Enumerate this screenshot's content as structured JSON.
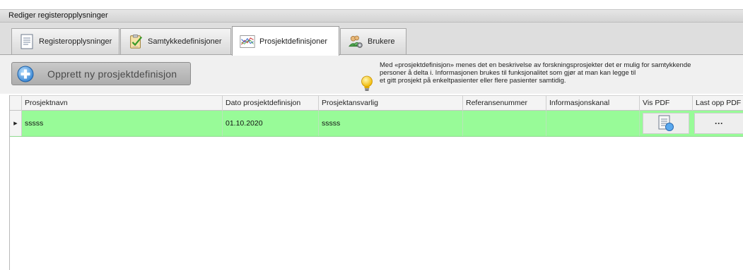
{
  "window": {
    "title": "Rediger registeropplysninger"
  },
  "tabs": [
    {
      "label": "Registeropplysninger",
      "icon": "document-icon",
      "active": false
    },
    {
      "label": "Samtykkedefinisjoner",
      "icon": "clipboard-check-icon",
      "active": false
    },
    {
      "label": "Prosjektdefinisjoner",
      "icon": "chart-icon",
      "active": true
    },
    {
      "label": "Brukere",
      "icon": "users-gear-icon",
      "active": false
    }
  ],
  "toolbar": {
    "new_button_label": "Opprett ny prosjektdefinisjon",
    "info_icon": "lightbulb-icon",
    "info_lines": [
      "Med «prosjektdefinisjon» menes det en beskrivelse av forskningsprosjekter det er mulig for samtykkende",
      "personer å delta i. Informasjonen brukes til funksjonalitet som gjør at man kan legge til",
      "et gitt prosjekt på enkeltpasienter eller flere pasienter samtidig."
    ]
  },
  "grid": {
    "columns": [
      "Prosjektnavn",
      "Dato prosjektdefinisjon",
      "Prosjektansvarlig",
      "Referansenummer",
      "Informasjonskanal",
      "Vis PDF",
      "Last opp PDF"
    ],
    "rows": [
      {
        "prosjektnavn": "sssss",
        "dato": "01.10.2020",
        "ansvarlig": "sssss",
        "referanse": "",
        "kanal": "",
        "vis_pdf_icon": "pdf-view-icon",
        "upload_label": "···"
      }
    ],
    "row_color": "#98fb98"
  },
  "colors": {
    "accent_selected_row": "#98fb98",
    "button_gray": "#b8b8b8"
  }
}
